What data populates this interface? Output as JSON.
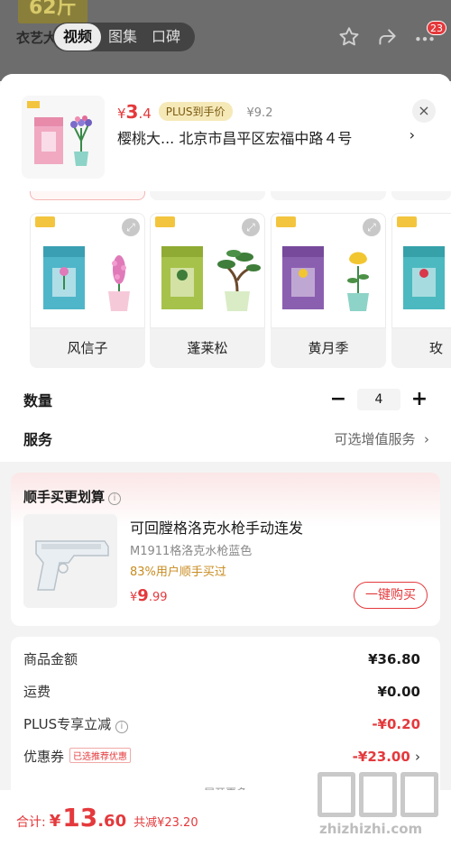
{
  "top": {
    "badge": "62斤",
    "shop_name": "衣艺大",
    "tabs": [
      {
        "label": "视频",
        "active": true
      },
      {
        "label": "图集",
        "active": false
      },
      {
        "label": "口碑",
        "active": false
      }
    ],
    "cart_count": "23"
  },
  "header": {
    "price_symbol": "¥",
    "price_int": "3",
    "price_dec": ".4",
    "plus_tag": "PLUS到手价",
    "orig_price": "¥9.2",
    "address": "樱桃大...  北京市昌平区宏福中路４号",
    "address_chevron": "›",
    "close": "×"
  },
  "variants": [
    {
      "label": "风信子",
      "box_color": "#4fb6c9",
      "flower": "#e07ab9"
    },
    {
      "label": "蓬莱松",
      "box_color": "#a6c24a",
      "flower": "#3f7d3a"
    },
    {
      "label": "黄月季",
      "box_color": "#8b5fb0",
      "flower": "#f2c631"
    },
    {
      "label": "玫",
      "box_color": "#4cb9c0",
      "flower": "#d9394a"
    }
  ],
  "quantity": {
    "label": "数量",
    "minus": "−",
    "value": "4",
    "plus": "+"
  },
  "service": {
    "label": "服务",
    "value": "可选增值服务",
    "chevron": "›"
  },
  "upsell": {
    "title": "顺手买更划算",
    "info": "i",
    "name": "可回膛格洛克水枪手动连发",
    "sub": "M1911格洛克水枪蓝色",
    "rate": "83%用户顺手买过",
    "price_symbol": "¥",
    "price_int": "9",
    "price_dec": ".99",
    "buy_label": "一键购买"
  },
  "summary": {
    "rows": [
      {
        "k": "商品金额",
        "v": "¥36.80",
        "red": false
      },
      {
        "k": "运费",
        "v": "¥0.00",
        "red": false
      },
      {
        "k": "PLUS专享立减",
        "v": "-¥0.20",
        "red": true
      },
      {
        "k": "优惠券",
        "v": "-¥23.00",
        "red": true
      }
    ],
    "coupon_tag": "已选推荐优惠",
    "more": "展开更多"
  },
  "bottom": {
    "total_label": "合计:",
    "symbol": "¥",
    "amount_int": "13",
    "amount_dec": ".60",
    "saved": "共减¥23.20"
  },
  "watermark": {
    "url": "zhizhizhi.com"
  },
  "colors": {
    "accent_red": "#e4393c",
    "plus_gold": "#7a5a12"
  }
}
